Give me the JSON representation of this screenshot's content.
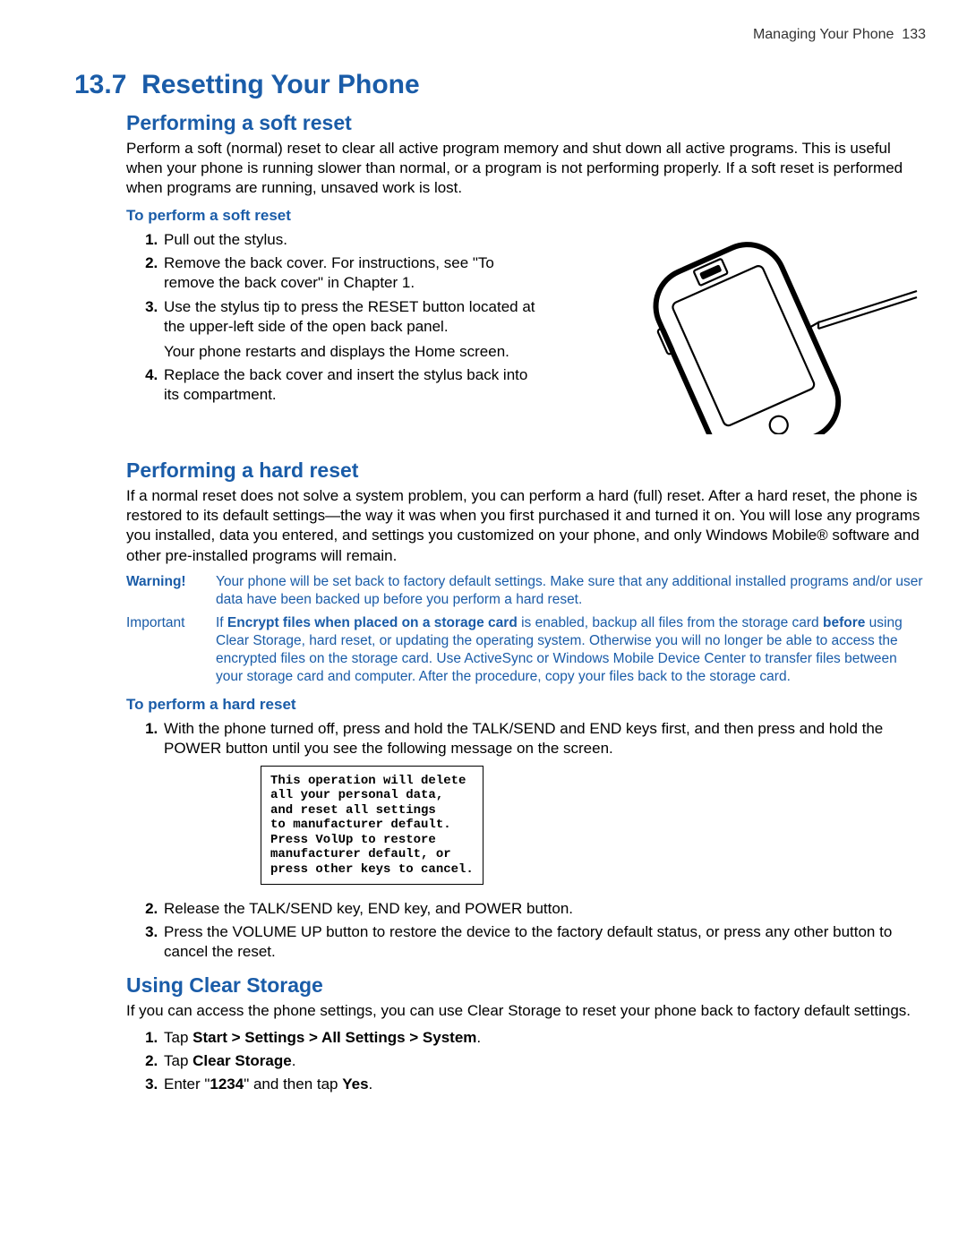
{
  "header": {
    "running_head": "Managing Your Phone",
    "page_number": "133"
  },
  "section": {
    "number": "13.7",
    "title": "Resetting Your Phone"
  },
  "soft": {
    "heading": "Performing a soft reset",
    "intro": "Perform a soft (normal) reset to clear all active program memory and shut down all active programs. This is useful when your phone is running slower than normal, or a program is not performing properly. If a soft reset is performed when programs are running, unsaved work is lost.",
    "procedure_title": "To perform a soft reset",
    "steps": {
      "s1": "Pull out the stylus.",
      "s2": "Remove the back cover. For instructions, see \"To remove the back cover\" in Chapter 1.",
      "s3": "Use the stylus tip to press the RESET button located at the upper-left side of the open back panel.",
      "s3_note": "Your phone restarts and displays the Home screen.",
      "s4": "Replace the back cover and insert the stylus back into its compartment."
    }
  },
  "hard": {
    "heading": "Performing a hard reset",
    "intro": "If a normal reset does not solve a system problem, you can perform a hard (full) reset. After a hard reset, the phone is restored to its default settings—the way it was when you first purchased it and turned it on. You will lose any programs you installed, data you entered, and settings you customized on your phone, and only Windows Mobile® software and other pre-installed programs will remain.",
    "warning_label": "Warning!",
    "warning_body": "Your phone will be set back to factory default settings. Make sure that any additional installed programs and/or user data have been backed up before you perform a hard reset.",
    "important_label": "Important",
    "important_pre": "If ",
    "important_bold1": "Encrypt files when placed on a storage card",
    "important_mid": " is enabled, backup all files from the storage card ",
    "important_bold2": "before",
    "important_post": " using Clear Storage, hard reset, or updating the operating system. Otherwise you will no longer be able to access the encrypted files on the storage card. Use ActiveSync or Windows Mobile Device Center to transfer files between your storage card and computer. After the procedure, copy your files back to the storage card.",
    "procedure_title": "To perform a hard reset",
    "steps": {
      "s1": "With the phone turned off, press and hold the TALK/SEND and END keys first, and then press and hold the POWER button until you see the following message on the screen.",
      "screen_msg": "This operation will delete\nall your personal data,\nand reset all settings\nto manufacturer default.\nPress VolUp to restore\nmanufacturer default, or\npress other keys to cancel.",
      "s2": "Release the TALK/SEND key, END key, and POWER button.",
      "s3": "Press the VOLUME UP button to restore the device to the factory default status, or press any other button to cancel the reset."
    }
  },
  "clear": {
    "heading": "Using Clear Storage",
    "intro": "If you can access the phone settings, you can use Clear Storage to reset your phone back to factory default settings.",
    "steps": {
      "s1_pre": "Tap ",
      "s1_bold": "Start > Settings > All Settings > System",
      "s1_post": ".",
      "s2_pre": "Tap ",
      "s2_bold": "Clear Storage",
      "s2_post": ".",
      "s3_pre": "Enter \"",
      "s3_bold1": "1234",
      "s3_mid": "\" and then tap ",
      "s3_bold2": "Yes",
      "s3_post": "."
    }
  }
}
